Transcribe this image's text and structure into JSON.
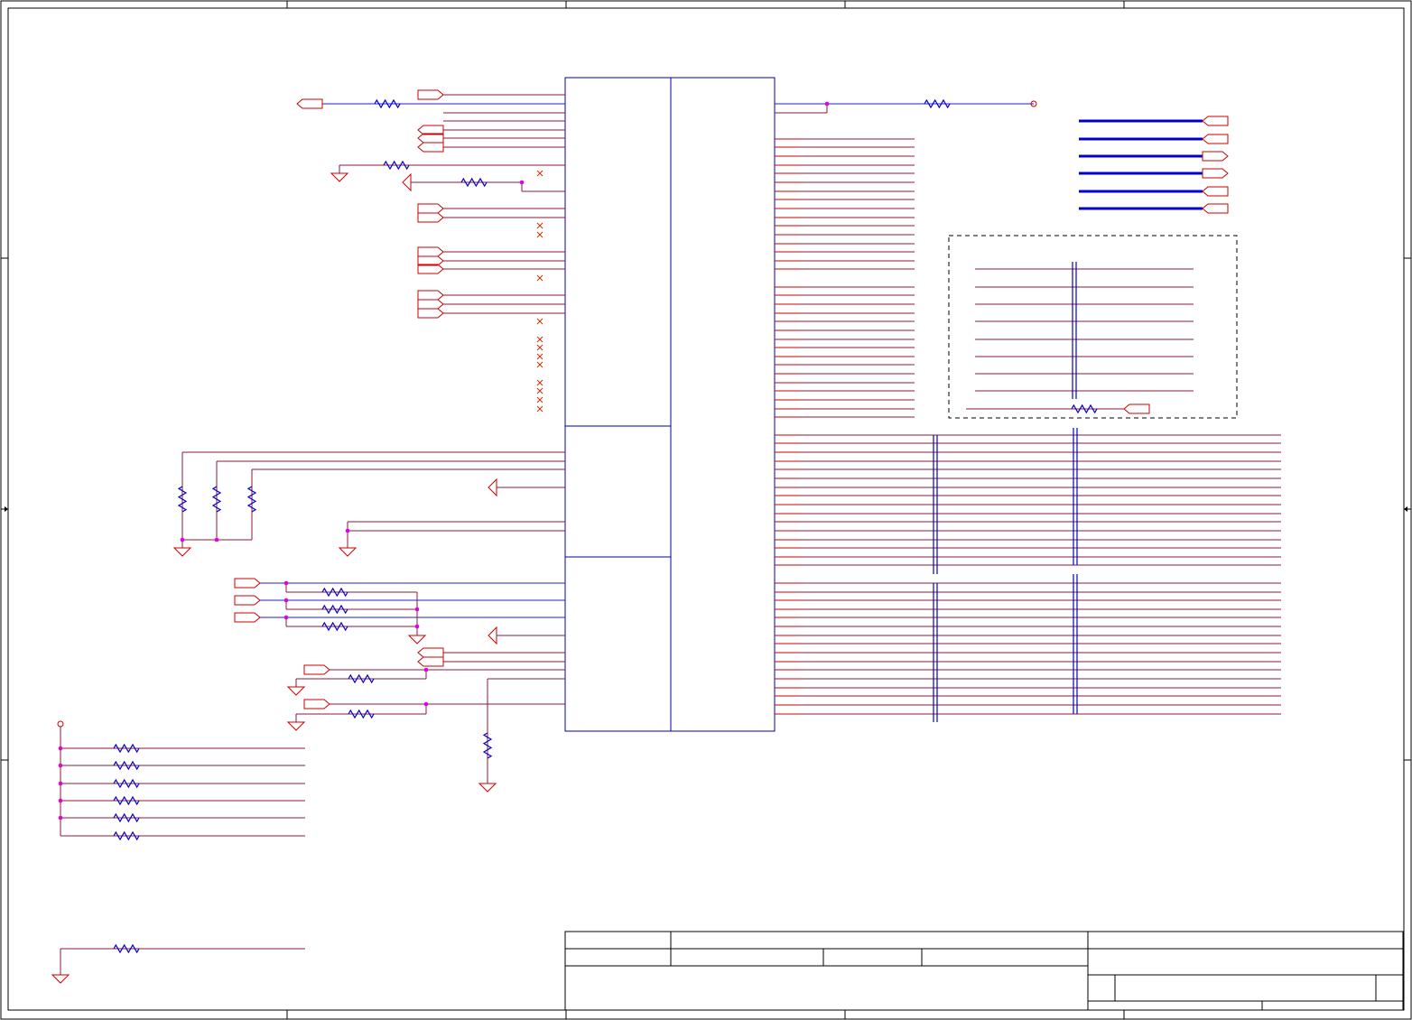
{
  "sheet": {
    "title_block": {
      "title": "",
      "size": "",
      "document_number": "",
      "revision": "",
      "date": "",
      "sheet": ""
    }
  },
  "colors": {
    "wire": "#8b1a3a",
    "power_wire": "#cc0000",
    "net_blue": "#1f1fd0",
    "bus": "#0000cc",
    "resistor": "#0000cc",
    "port": "#cc0000",
    "junction": "#e000e0",
    "frame": "#000000",
    "part_outline": "#0000aa"
  },
  "icons": {
    "ground": "ground-icon",
    "resistor": "resistor-icon",
    "offpage_port": "offpage-connector-icon",
    "no_connect": "no-connect-icon",
    "junction": "junction-dot-icon",
    "power_pin": "power-pin-icon"
  }
}
